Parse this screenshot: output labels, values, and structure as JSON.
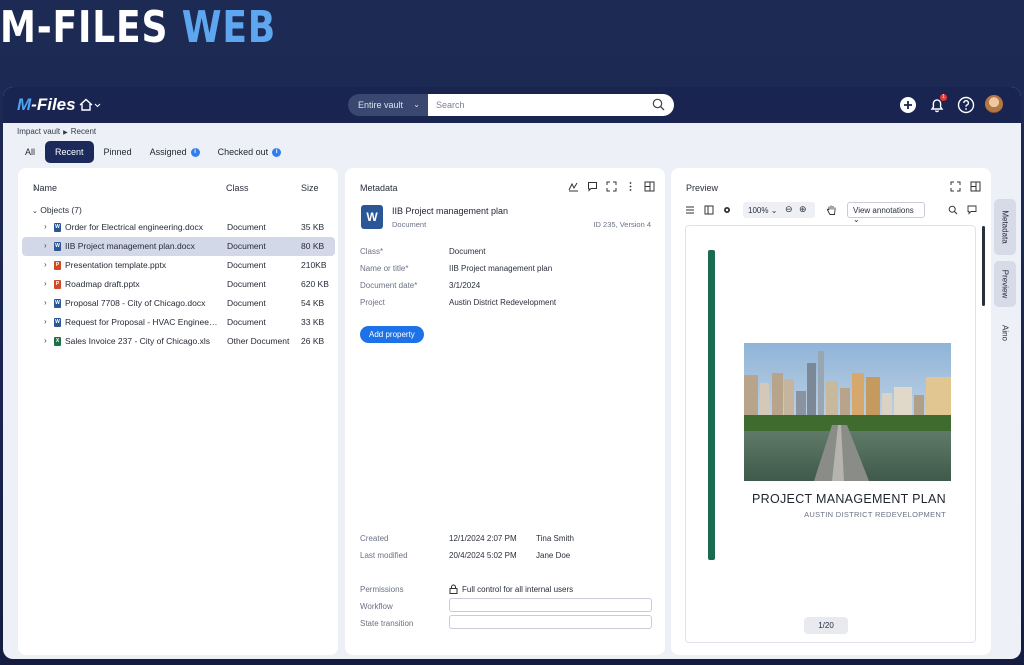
{
  "hero": {
    "word1": "M-FILES",
    "word2": "WEB"
  },
  "app": {
    "logo_m": "M",
    "logo_rest": "-Files"
  },
  "search": {
    "scope": "Entire vault",
    "placeholder": "Search"
  },
  "topbar": {
    "notification_count": "1"
  },
  "breadcrumb": {
    "vault": "Impact vault",
    "current": "Recent"
  },
  "tabs": {
    "all": "All",
    "recent": "Recent",
    "pinned": "Pinned",
    "assigned": "Assigned",
    "checked_out": "Checked out"
  },
  "list": {
    "columns": {
      "name": "Name",
      "class": "Class",
      "size": "Size"
    },
    "group_label": "Objects (7)",
    "rows": [
      {
        "name": "Order for Electrical engineering.docx",
        "class": "Document",
        "size": "35 KB",
        "type": "W",
        "color": "#2b5797"
      },
      {
        "name": "IIB Project management plan.docx",
        "class": "Document",
        "size": "80 KB",
        "type": "W",
        "color": "#2b5797"
      },
      {
        "name": "Presentation template.pptx",
        "class": "Document",
        "size": "210KB",
        "type": "P",
        "color": "#d24726"
      },
      {
        "name": "Roadmap draft.pptx",
        "class": "Document",
        "size": "620 KB",
        "type": "P",
        "color": "#d24726"
      },
      {
        "name": "Proposal 7708 - City of Chicago.docx",
        "class": "Document",
        "size": "54 KB",
        "type": "W",
        "color": "#2b5797"
      },
      {
        "name": "Request for Proposal - HVAC Engineering.docx",
        "class": "Document",
        "size": "33 KB",
        "type": "W",
        "color": "#2b5797"
      },
      {
        "name": "Sales Invoice 237 - City of Chicago.xls",
        "class": "Other Document",
        "size": "26 KB",
        "type": "X",
        "color": "#1e7145"
      }
    ]
  },
  "metadata": {
    "title": "Metadata",
    "doc_icon": "W",
    "doc_title": "IIB Project management plan",
    "doc_class": "Document",
    "doc_id": "ID 235, Version 4",
    "props": [
      {
        "key": "Class*",
        "value": "Document"
      },
      {
        "key": "Name or title*",
        "value": "IIB Project management plan"
      },
      {
        "key": "Document date*",
        "value": "3/1/2024"
      },
      {
        "key": "Project",
        "value": "Austin District Redevelopment"
      }
    ],
    "add_property": "Add property",
    "created_label": "Created",
    "created_date": "12/1/2024 2:07 PM",
    "created_by": "Tina Smith",
    "modified_label": "Last modified",
    "modified_date": "20/4/2024 5:02 PM",
    "modified_by": "Jane Doe",
    "permissions_label": "Permissions",
    "permissions_value": "Full control for all internal users",
    "workflow_label": "Workflow",
    "state_label": "State transition"
  },
  "preview": {
    "title": "Preview",
    "zoom": "100%",
    "annotations": "View annotations",
    "plan_title": "PROJECT MANAGEMENT PLAN",
    "plan_subtitle": "AUSTIN DISTRICT REDEVELOPMENT",
    "page": "1/20"
  },
  "side_tabs": {
    "metadata": "Metadata",
    "preview": "Preview",
    "aino": "Aino"
  }
}
